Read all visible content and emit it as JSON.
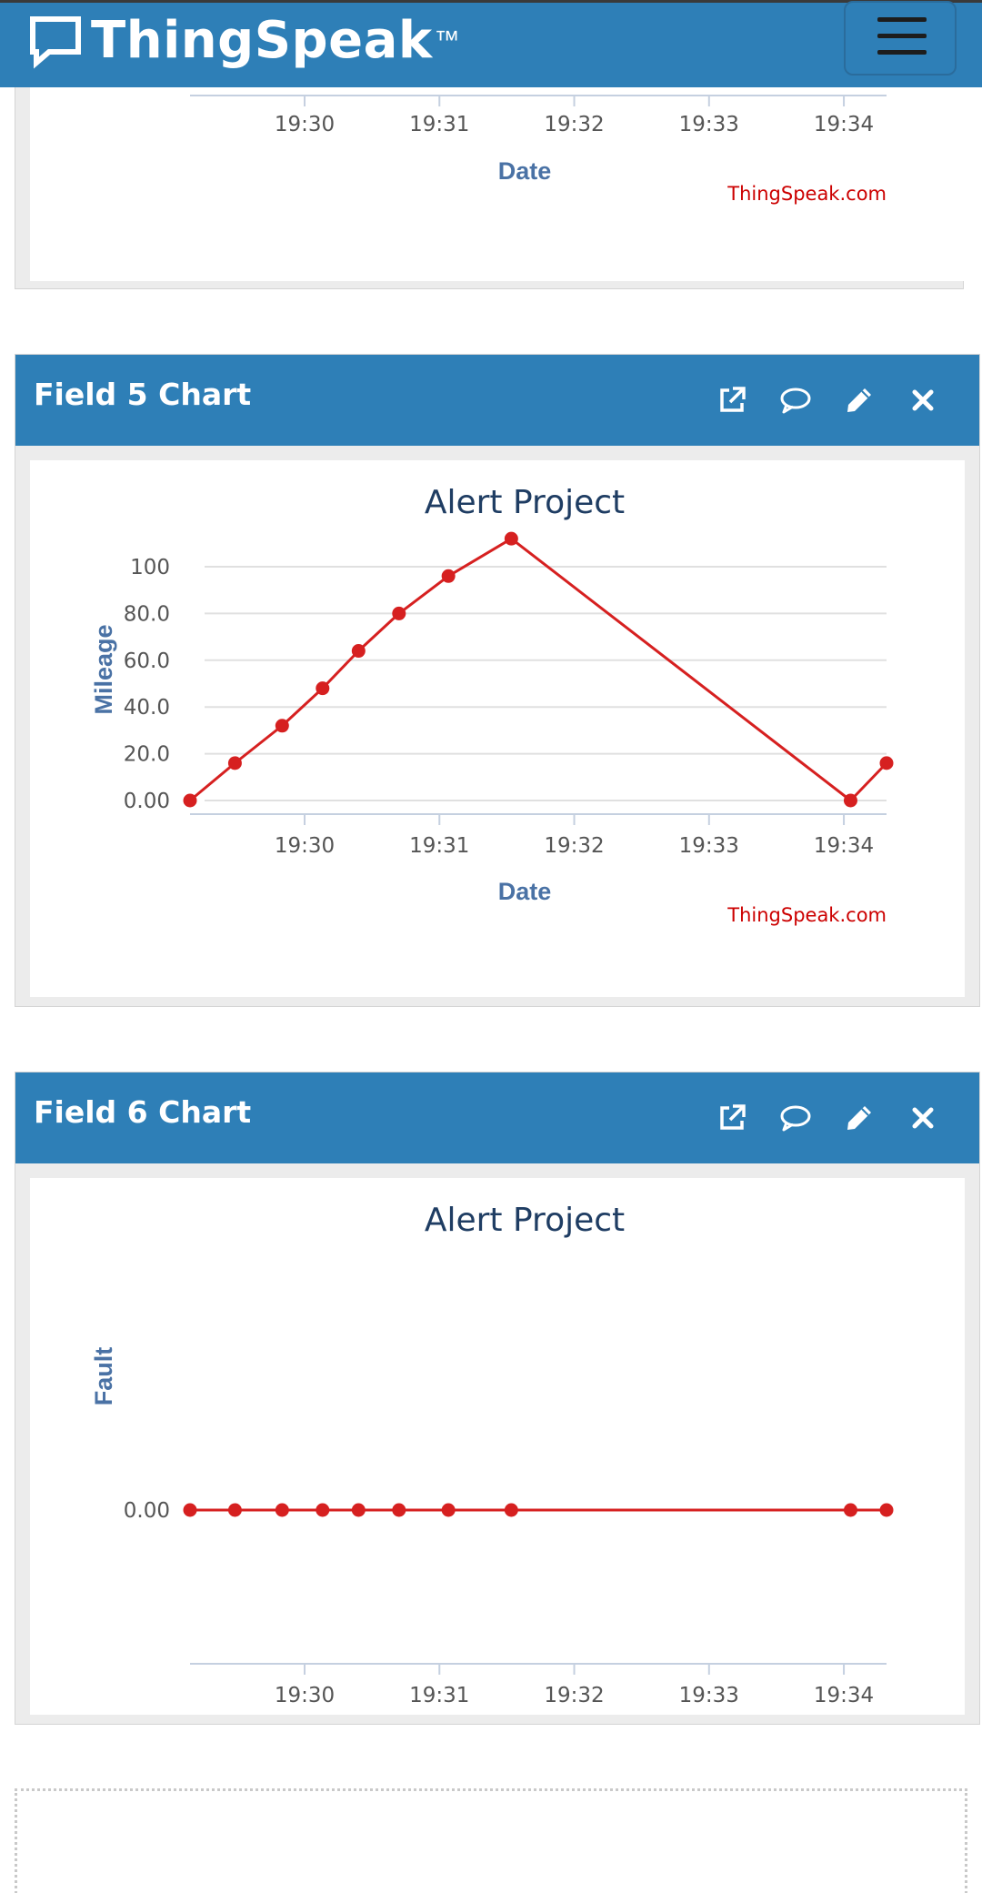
{
  "navbar": {
    "brand": "ThingSpeak",
    "trademark": "™",
    "icons": {
      "logo": "speech-bubble-logo-icon",
      "menu": "hamburger-menu-icon"
    }
  },
  "top_chart": {
    "x_ticks": [
      "19:30",
      "19:31",
      "19:32",
      "19:33",
      "19:34"
    ],
    "xlabel": "Date",
    "credit": "ThingSpeak.com"
  },
  "panels": [
    {
      "title": "Field 5 Chart",
      "actions": [
        "external-link-icon",
        "comment-icon",
        "pencil-icon",
        "close-icon"
      ]
    },
    {
      "title": "Field 6 Chart",
      "actions": [
        "external-link-icon",
        "comment-icon",
        "pencil-icon",
        "close-icon"
      ]
    }
  ],
  "colors": {
    "header_blue": "#2e7fb7",
    "series_red": "#d62020",
    "title_navy": "#1f3d63",
    "axis_label_blue": "#4a72a5",
    "credit_red": "#cc0000"
  },
  "chart_data": [
    {
      "type": "line",
      "title": "Alert Project",
      "xlabel": "Date",
      "ylabel": "Mileage",
      "credit": "ThingSpeak.com",
      "x_ticks": [
        "19:30",
        "19:31",
        "19:32",
        "19:33",
        "19:34"
      ],
      "y_ticks": [
        "0.00",
        "20.0",
        "40.0",
        "60.0",
        "80.0",
        "100"
      ],
      "ylim": [
        0,
        110
      ],
      "xlim": [
        "19:29:09",
        "19:34:19"
      ],
      "grid": true,
      "series": [
        {
          "color": "#d62020",
          "x": [
            "19:29:09",
            "19:29:29",
            "19:29:50",
            "19:30:08",
            "19:30:24",
            "19:30:42",
            "19:31:04",
            "19:31:32",
            "19:34:03",
            "19:34:19"
          ],
          "values": [
            0,
            16,
            32,
            48,
            64,
            80,
            96,
            112,
            0,
            16
          ]
        }
      ]
    },
    {
      "type": "line",
      "title": "Alert Project",
      "xlabel": "Date",
      "ylabel": "Fault",
      "credit": "ThingSpeak.com",
      "x_ticks": [
        "19:30",
        "19:31",
        "19:32",
        "19:33",
        "19:34"
      ],
      "y_ticks": [
        "0.00"
      ],
      "xlim": [
        "19:29:09",
        "19:34:19"
      ],
      "grid": true,
      "series": [
        {
          "color": "#d62020",
          "x": [
            "19:29:09",
            "19:29:29",
            "19:29:50",
            "19:30:08",
            "19:30:24",
            "19:30:42",
            "19:31:04",
            "19:31:32",
            "19:34:03",
            "19:34:19"
          ],
          "values": [
            0,
            0,
            0,
            0,
            0,
            0,
            0,
            0,
            0,
            0
          ]
        }
      ]
    }
  ]
}
